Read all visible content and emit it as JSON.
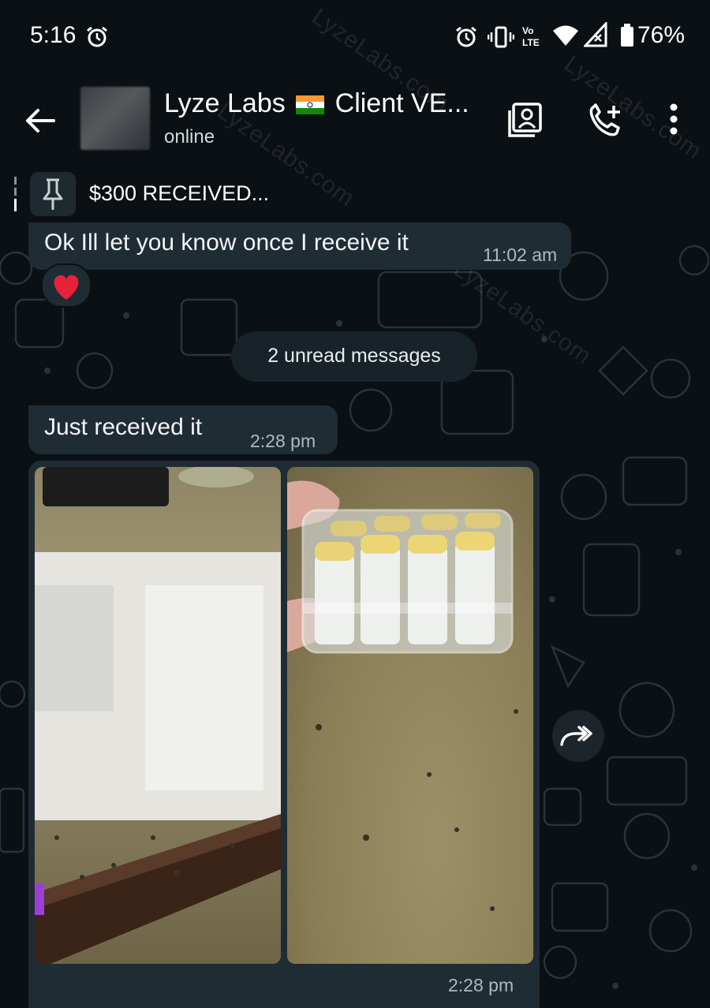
{
  "status_bar": {
    "time": "5:16",
    "battery": "76%"
  },
  "header": {
    "title_before_flag": "Lyze Labs",
    "title_after_flag": "Client VE...",
    "status": "online"
  },
  "pinned": {
    "text": "$300 RECEIVED..."
  },
  "messages": [
    {
      "text": "Ok Ill let you know once I receive it",
      "time": "11:02 am",
      "reaction": "❤️"
    },
    {
      "text": "Just received it",
      "time": "2:28 pm"
    }
  ],
  "unread_divider": "2 unread messages",
  "media_message": {
    "time": "2:28 pm",
    "photos": [
      "blurred-photo",
      "vials-box-photo"
    ]
  },
  "watermark_text": "LyzeLabs.com",
  "colors": {
    "background": "#0b1014",
    "bubble": "#1f2c33",
    "pill": "#182229",
    "text": "#e9edef",
    "meta": "#aebac1"
  }
}
